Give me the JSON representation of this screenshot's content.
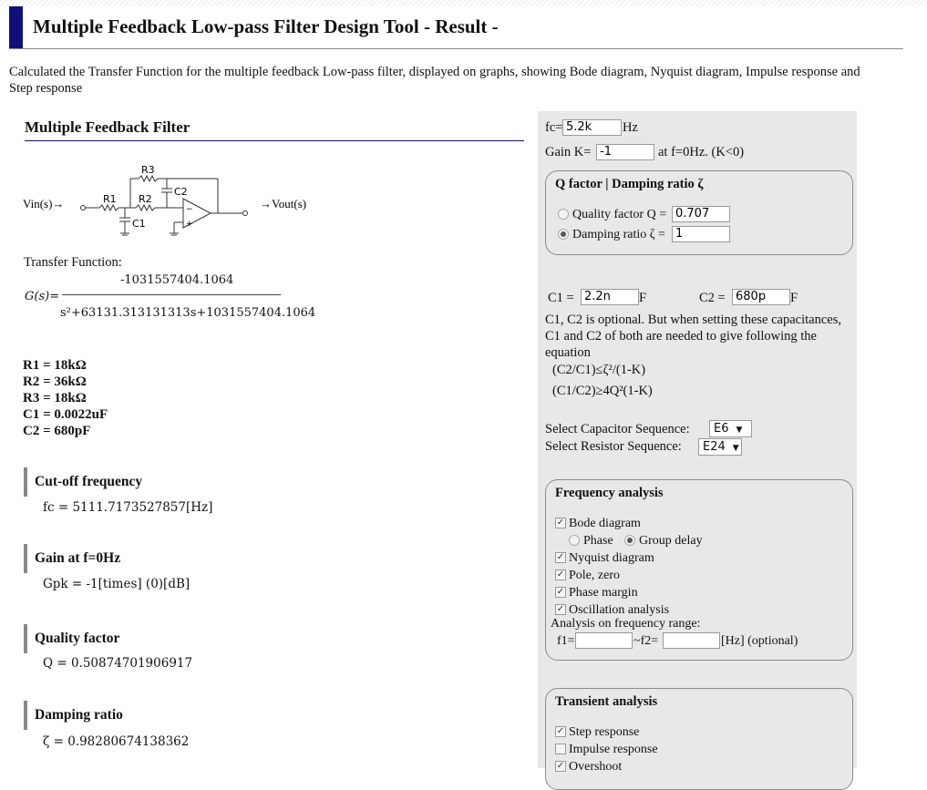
{
  "header": {
    "title": "Multiple Feedback Low-pass Filter Design Tool - Result -"
  },
  "intro": "Calculated the Transfer Function for the multiple feedback Low-pass filter, displayed on graphs, showing Bode diagram, Nyquist diagram, Impulse response and Step response",
  "filter": {
    "title": "Multiple Feedback Filter",
    "circuit": {
      "vin": "Vin(s)→",
      "vout": "→Vout(s)",
      "r1": "R1",
      "r2": "R2",
      "r3": "R3",
      "c1": "C1",
      "c2": "C2"
    },
    "tf_label": "Transfer Function:",
    "tf_numerator": "-1031557404.1064",
    "tf_g": "G(s)=",
    "tf_denominator": "s²+63131.313131313s+1031557404.1064"
  },
  "values": [
    "R1 = 18kΩ",
    "R2 = 36kΩ",
    "R3 = 18kΩ",
    "C1 = 0.0022uF",
    "C2 = 680pF"
  ],
  "results": {
    "cutoff_title": "Cut-off frequency",
    "cutoff_value": "fc = 5111.7173527857[Hz]",
    "gain_title": "Gain at f=0Hz",
    "gain_value": "Gpk = -1[times] (0)[dB]",
    "q_title": "Quality factor",
    "q_value": "Q = 0.50874701906917",
    "damping_title": "Damping ratio",
    "damping_value": "ζ = 0.98280674138362"
  },
  "form": {
    "fc_label": "fc=",
    "fc_value": "5.2k",
    "fc_unit": "Hz",
    "gain_label": "Gain K=",
    "gain_value": "-1",
    "gain_note": "at f=0Hz. (K<0)",
    "qbox_title": "Q factor | Damping ratio ζ",
    "q_option_label": "Quality factor Q =",
    "q_option_value": "0.707",
    "zeta_option_label": "Damping ratio ζ =",
    "zeta_option_value": "1",
    "c1_label": "C1 =",
    "c1_value": "2.2n",
    "c1_unit": "F",
    "c2_label": "C2 =",
    "c2_value": "680p",
    "c2_unit": "F",
    "cap_note": "C1, C2 is optional. But when setting these capacitances, C1 and C2 of both are needed to give following the equation",
    "eq1": "(C2/C1)≤ζ²/(1-K)",
    "eq2": "(C1/C2)≥4Q²(1-K)",
    "cap_seq_label": "Select Capacitor Sequence:",
    "cap_seq_value": "E6",
    "res_seq_label": "Select Resistor Sequence:",
    "res_seq_value": "E24"
  },
  "freq": {
    "title": "Frequency analysis",
    "bode": "Bode diagram",
    "phase": "Phase",
    "group_delay": "Group delay",
    "nyquist": "Nyquist diagram",
    "pole_zero": "Pole, zero",
    "phase_margin": "Phase margin",
    "oscillation": "Oscillation analysis",
    "range_label": "Analysis on frequency range:",
    "f1_label": "f1=",
    "f2_label": "~f2=",
    "range_unit": "[Hz] (optional)"
  },
  "transient": {
    "title": "Transient analysis",
    "step": "Step response",
    "impulse": "Impulse response",
    "overshoot": "Overshoot"
  }
}
